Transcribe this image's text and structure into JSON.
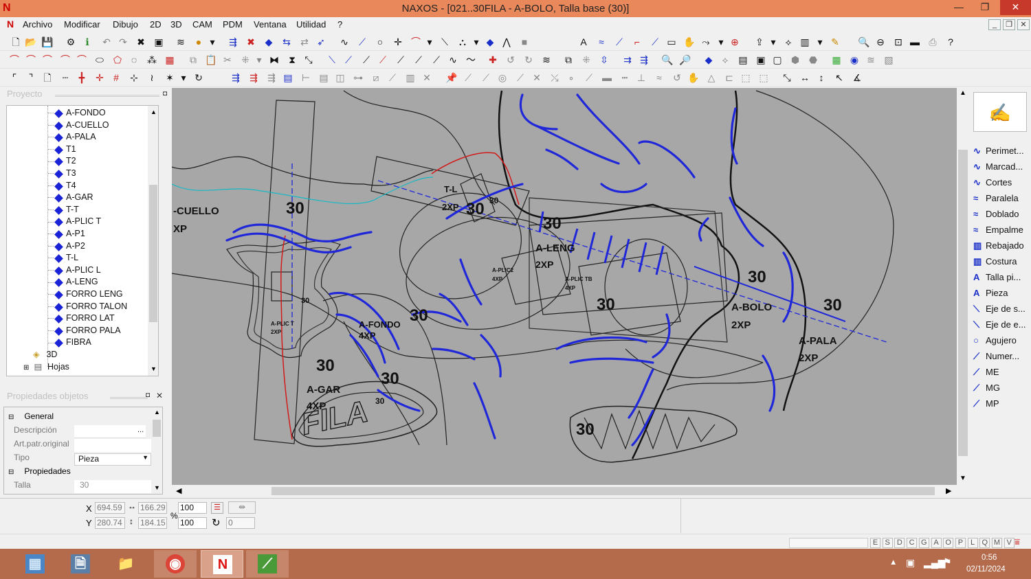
{
  "window": {
    "title": "NAXOS - [021..30FILA - A-BOLO, Talla base (30)]",
    "logo": "N",
    "minimize": "—",
    "restore": "❐",
    "close": "✕"
  },
  "menu": [
    "Archivo",
    "Modificar",
    "Dibujo",
    "2D",
    "3D",
    "CAM",
    "PDM",
    "Ventana",
    "Utilidad",
    "?"
  ],
  "project_panel": {
    "title": "Proyecto",
    "items": [
      "A-FONDO",
      "A-CUELLO",
      "A-PALA",
      "T1",
      "T2",
      "T3",
      "T4",
      "A-GAR",
      "T-T",
      "A-PLIC T",
      "A-P1",
      "A-P2",
      "T-L",
      "A-PLIC L",
      "A-LENG",
      "FORRO LENG",
      "FORRO TALON",
      "FORRO LAT",
      "FORRO PALA",
      "FIBRA"
    ],
    "folder_3d": "3D",
    "folder_hojas": "Hojas"
  },
  "properties_panel": {
    "title": "Propiedades objetos",
    "section_general": "General",
    "descripcion_label": "Descripción",
    "artpatr_label": "Art.patr.original",
    "tipo_label": "Tipo",
    "tipo_value": "Pieza",
    "section_propiedades": "Propiedades",
    "talla_label": "Talla",
    "talla_value": "30",
    "ellipsis": "..."
  },
  "canvas_labels": {
    "cuello": "-CUELLO",
    "cuello_qty": "XP",
    "n30_a": "30",
    "t_l": "T-L",
    "t_l_qty": "2XP",
    "n30_b": "30",
    "n30_small": "30",
    "n30_c": "30",
    "a_leng": "A-LENG",
    "a_leng_qty": "2XP",
    "a_plic2": "A-PLIC2",
    "a_plic2_qty": "4XP",
    "a_plic_tb": "A-PLIC TB",
    "a_plic_tb_qty": "4XP",
    "a_bolo": "A-BOLO",
    "a_bolo_qty": "2XP",
    "a_pala": "A-PALA",
    "a_pala_qty": "2XP",
    "n30_d": "30",
    "n30_e": "30",
    "n30_f": "30",
    "a_fondo": "A-FONDO",
    "a_fondo_qty": "4XP",
    "n30_g": "30",
    "a_plic_t": "A-PLIC T",
    "a_plic_t_qty": "2XP",
    "n30_h": "30",
    "a_gar": "A-GAR",
    "a_gar_qty": "4XP",
    "n30_i": "30",
    "n30_j": "30",
    "fila": "FILA",
    "n30_k": "30",
    "n30_l": "30"
  },
  "right_panel": {
    "items": [
      "Perimet...",
      "Marcad...",
      "Cortes",
      "Paralela",
      "Doblado",
      "Empalme",
      "Rebajado",
      "Costura",
      "Talla pi...",
      "Pieza",
      "Eje de s...",
      "Eje de e...",
      "Agujero",
      "Numer...",
      "ME",
      "MG",
      "MP"
    ]
  },
  "coords": {
    "x_label": "X",
    "y_label": "Y",
    "x": "694.59",
    "y": "280.74",
    "w": "166.29",
    "h": "184.15",
    "pct_x": "100",
    "pct_y": "100",
    "rot": "0",
    "pct_symbol": "%"
  },
  "status_keys": [
    "E",
    "S",
    "D",
    "C",
    "G",
    "A",
    "O",
    "P",
    "L",
    "Q",
    "M",
    "V"
  ],
  "taskbar": {
    "time": "0:56",
    "date": "02/11/2024"
  },
  "colors": {
    "titlebar": "#e9885b",
    "canvas": "#a7a7a7",
    "blue_lines": "#1f27d9",
    "taskbar": "#b36b4c"
  }
}
